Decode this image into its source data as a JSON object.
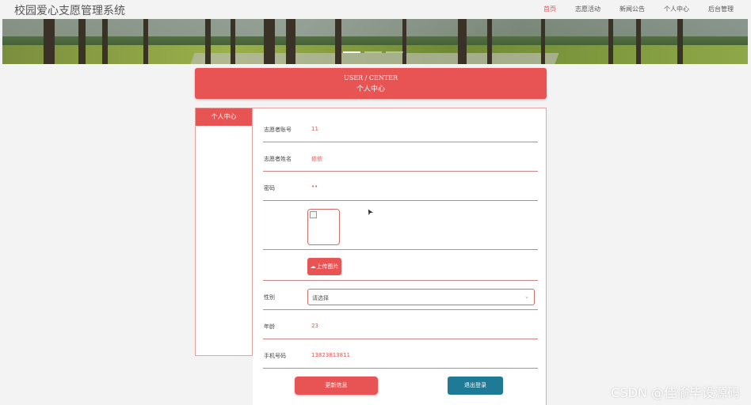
{
  "site": {
    "title": "校园爱心支愿管理系统"
  },
  "nav": [
    {
      "label": "首页",
      "active": true
    },
    {
      "label": "志愿活动",
      "active": false
    },
    {
      "label": "新闻公告",
      "active": false
    },
    {
      "label": "个人中心",
      "active": false
    },
    {
      "label": "后台管理",
      "active": false
    }
  ],
  "header": {
    "en": "USER / CENTER",
    "cn": "个人中心"
  },
  "sidebar": {
    "item": "个人中心"
  },
  "form": {
    "account_label": "志愿者账号",
    "account_value": "11",
    "name_label": "志愿者姓名",
    "name_value": "依依",
    "password_label": "密码",
    "password_value": "••",
    "upload_label": "上传图片",
    "gender_label": "性别",
    "gender_placeholder": "请选择",
    "age_label": "年龄",
    "age_value": "23",
    "phone_label": "手机号码",
    "phone_value": "13823813811"
  },
  "buttons": {
    "update": "更新信息",
    "logout": "退出登录"
  },
  "watermark": "CSDN @佳愉毕设源码",
  "colors": {
    "accent": "#e85454",
    "logout": "#1f7a96"
  }
}
